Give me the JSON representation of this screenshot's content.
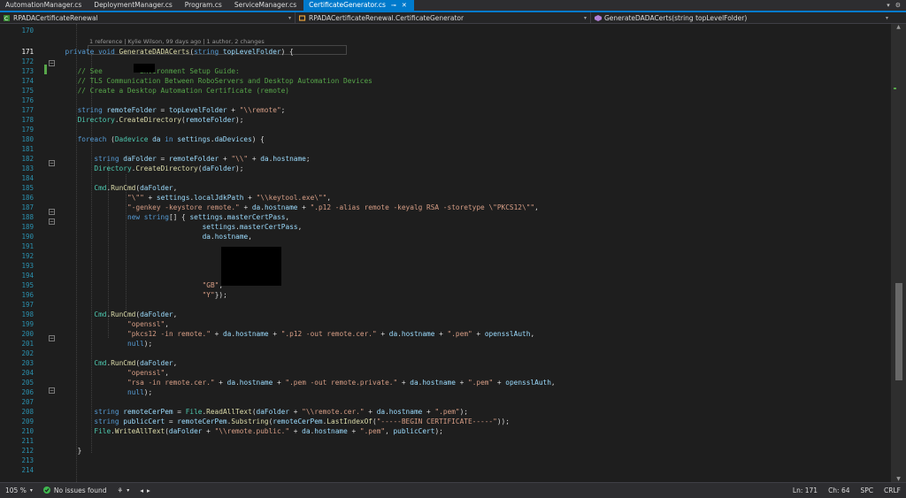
{
  "tabs": [
    {
      "label": "AutomationManager.cs",
      "active": false
    },
    {
      "label": "DeploymentManager.cs",
      "active": false
    },
    {
      "label": "Program.cs",
      "active": false
    },
    {
      "label": "ServiceManager.cs",
      "active": false
    },
    {
      "label": "CertificateGenerator.cs",
      "active": true
    }
  ],
  "tab_icons": {
    "pin": "pin-icon",
    "close": "close-icon",
    "overflow": "chevron-down-icon",
    "settings": "gear-icon"
  },
  "navbar": {
    "project": "RPADACertificateRenewal",
    "type": "RPADACertificateRenewal.CertificateGenerator",
    "member": "GenerateDADACerts(string topLevelFolder)"
  },
  "codelens": "1 reference | Kylie Wilson, 99 days ago | 1 author, 2 changes",
  "current_line": "171",
  "lines": [
    {
      "n": "170",
      "tokens": []
    },
    {
      "n": "171",
      "tokens": [
        {
          "t": "k",
          "x": "private "
        },
        {
          "t": "k",
          "x": "void "
        },
        {
          "t": "m",
          "x": "GenerateDADACerts"
        },
        {
          "t": "p",
          "x": "("
        },
        {
          "t": "k",
          "x": "string "
        },
        {
          "t": "v",
          "x": "topLevelFolder"
        },
        {
          "t": "p",
          "x": ") {"
        }
      ]
    },
    {
      "n": "172",
      "tokens": []
    },
    {
      "n": "173",
      "tokens": [
        {
          "t": "c",
          "x": "// See "
        },
        {
          "t": "c",
          "x": "        "
        },
        {
          "t": "c",
          "x": "Environment Setup Guide:"
        }
      ]
    },
    {
      "n": "174",
      "tokens": [
        {
          "t": "c",
          "x": "// TLS Communication Between RoboServers and Desktop Automation Devices"
        }
      ]
    },
    {
      "n": "175",
      "tokens": [
        {
          "t": "c",
          "x": "// Create a Desktop Automation Certificate (remote)"
        }
      ]
    },
    {
      "n": "176",
      "tokens": []
    },
    {
      "n": "177",
      "tokens": [
        {
          "t": "k",
          "x": "string "
        },
        {
          "t": "v",
          "x": "remoteFolder"
        },
        {
          "t": "p",
          "x": " = "
        },
        {
          "t": "v",
          "x": "topLevelFolder"
        },
        {
          "t": "p",
          "x": " + "
        },
        {
          "t": "s",
          "x": "\"\\\\remote\""
        },
        {
          "t": "p",
          "x": ";"
        }
      ]
    },
    {
      "n": "178",
      "tokens": [
        {
          "t": "t",
          "x": "Directory"
        },
        {
          "t": "p",
          "x": "."
        },
        {
          "t": "m",
          "x": "CreateDirectory"
        },
        {
          "t": "p",
          "x": "("
        },
        {
          "t": "v",
          "x": "remoteFolder"
        },
        {
          "t": "p",
          "x": ");"
        }
      ]
    },
    {
      "n": "179",
      "tokens": []
    },
    {
      "n": "180",
      "tokens": [
        {
          "t": "k",
          "x": "foreach "
        },
        {
          "t": "p",
          "x": "("
        },
        {
          "t": "t",
          "x": "Dadevice "
        },
        {
          "t": "v",
          "x": "da"
        },
        {
          "t": "k",
          "x": " in "
        },
        {
          "t": "v",
          "x": "settings"
        },
        {
          "t": "p",
          "x": "."
        },
        {
          "t": "v",
          "x": "daDevices"
        },
        {
          "t": "p",
          "x": ") {"
        }
      ]
    },
    {
      "n": "181",
      "tokens": []
    },
    {
      "n": "182",
      "tokens": [
        {
          "t": "k",
          "x": "string "
        },
        {
          "t": "v",
          "x": "daFolder"
        },
        {
          "t": "p",
          "x": " = "
        },
        {
          "t": "v",
          "x": "remoteFolder"
        },
        {
          "t": "p",
          "x": " + "
        },
        {
          "t": "s",
          "x": "\"\\\\\""
        },
        {
          "t": "p",
          "x": " + "
        },
        {
          "t": "v",
          "x": "da"
        },
        {
          "t": "p",
          "x": "."
        },
        {
          "t": "v",
          "x": "hostname"
        },
        {
          "t": "p",
          "x": ";"
        }
      ]
    },
    {
      "n": "183",
      "tokens": [
        {
          "t": "t",
          "x": "Directory"
        },
        {
          "t": "p",
          "x": "."
        },
        {
          "t": "m",
          "x": "CreateDirectory"
        },
        {
          "t": "p",
          "x": "("
        },
        {
          "t": "v",
          "x": "daFolder"
        },
        {
          "t": "p",
          "x": ");"
        }
      ]
    },
    {
      "n": "184",
      "tokens": []
    },
    {
      "n": "185",
      "tokens": [
        {
          "t": "t",
          "x": "Cmd"
        },
        {
          "t": "p",
          "x": "."
        },
        {
          "t": "m",
          "x": "RunCmd"
        },
        {
          "t": "p",
          "x": "("
        },
        {
          "t": "v",
          "x": "daFolder"
        },
        {
          "t": "p",
          "x": ","
        }
      ]
    },
    {
      "n": "186",
      "tokens": [
        {
          "t": "s",
          "x": "\"\\\"\""
        },
        {
          "t": "p",
          "x": " + "
        },
        {
          "t": "v",
          "x": "settings"
        },
        {
          "t": "p",
          "x": "."
        },
        {
          "t": "v",
          "x": "localJdkPath"
        },
        {
          "t": "p",
          "x": " + "
        },
        {
          "t": "s",
          "x": "\"\\\\keytool.exe\\\"\""
        },
        {
          "t": "p",
          "x": ","
        }
      ]
    },
    {
      "n": "187",
      "tokens": [
        {
          "t": "s",
          "x": "\"-genkey -keystore remote.\""
        },
        {
          "t": "p",
          "x": " + "
        },
        {
          "t": "v",
          "x": "da"
        },
        {
          "t": "p",
          "x": "."
        },
        {
          "t": "v",
          "x": "hostname"
        },
        {
          "t": "p",
          "x": " + "
        },
        {
          "t": "s",
          "x": "\".p12 -alias remote -keyalg RSA -storetype \\\"PKCS12\\\"\""
        },
        {
          "t": "p",
          "x": ","
        }
      ]
    },
    {
      "n": "188",
      "tokens": [
        {
          "t": "k",
          "x": "new "
        },
        {
          "t": "k",
          "x": "string"
        },
        {
          "t": "p",
          "x": "[] { "
        },
        {
          "t": "v",
          "x": "settings"
        },
        {
          "t": "p",
          "x": "."
        },
        {
          "t": "v",
          "x": "masterCertPass"
        },
        {
          "t": "p",
          "x": ","
        }
      ]
    },
    {
      "n": "189",
      "tokens": [
        {
          "t": "v",
          "x": "settings"
        },
        {
          "t": "p",
          "x": "."
        },
        {
          "t": "v",
          "x": "masterCertPass"
        },
        {
          "t": "p",
          "x": ","
        }
      ]
    },
    {
      "n": "190",
      "tokens": [
        {
          "t": "v",
          "x": "da"
        },
        {
          "t": "p",
          "x": "."
        },
        {
          "t": "v",
          "x": "hostname"
        },
        {
          "t": "p",
          "x": ","
        }
      ]
    },
    {
      "n": "191",
      "tokens": []
    },
    {
      "n": "192",
      "tokens": []
    },
    {
      "n": "193",
      "tokens": []
    },
    {
      "n": "194",
      "tokens": []
    },
    {
      "n": "195",
      "tokens": [
        {
          "t": "s",
          "x": "\"GB\""
        },
        {
          "t": "p",
          "x": ","
        }
      ]
    },
    {
      "n": "196",
      "tokens": [
        {
          "t": "s",
          "x": "\"Y\""
        },
        {
          "t": "p",
          "x": "});"
        }
      ]
    },
    {
      "n": "197",
      "tokens": []
    },
    {
      "n": "198",
      "tokens": [
        {
          "t": "t",
          "x": "Cmd"
        },
        {
          "t": "p",
          "x": "."
        },
        {
          "t": "m",
          "x": "RunCmd"
        },
        {
          "t": "p",
          "x": "("
        },
        {
          "t": "v",
          "x": "daFolder"
        },
        {
          "t": "p",
          "x": ","
        }
      ]
    },
    {
      "n": "199",
      "tokens": [
        {
          "t": "s",
          "x": "\"openssl\""
        },
        {
          "t": "p",
          "x": ","
        }
      ]
    },
    {
      "n": "200",
      "tokens": [
        {
          "t": "s",
          "x": "\"pkcs12 -in remote.\""
        },
        {
          "t": "p",
          "x": " + "
        },
        {
          "t": "v",
          "x": "da"
        },
        {
          "t": "p",
          "x": "."
        },
        {
          "t": "v",
          "x": "hostname"
        },
        {
          "t": "p",
          "x": " + "
        },
        {
          "t": "s",
          "x": "\".p12 -out remote.cer.\""
        },
        {
          "t": "p",
          "x": " + "
        },
        {
          "t": "v",
          "x": "da"
        },
        {
          "t": "p",
          "x": "."
        },
        {
          "t": "v",
          "x": "hostname"
        },
        {
          "t": "p",
          "x": " + "
        },
        {
          "t": "s",
          "x": "\".pem\""
        },
        {
          "t": "p",
          "x": " + "
        },
        {
          "t": "v",
          "x": "opensslAuth"
        },
        {
          "t": "p",
          "x": ","
        }
      ]
    },
    {
      "n": "201",
      "tokens": [
        {
          "t": "k",
          "x": "null"
        },
        {
          "t": "p",
          "x": ");"
        }
      ]
    },
    {
      "n": "202",
      "tokens": []
    },
    {
      "n": "203",
      "tokens": [
        {
          "t": "t",
          "x": "Cmd"
        },
        {
          "t": "p",
          "x": "."
        },
        {
          "t": "m",
          "x": "RunCmd"
        },
        {
          "t": "p",
          "x": "("
        },
        {
          "t": "v",
          "x": "daFolder"
        },
        {
          "t": "p",
          "x": ","
        }
      ]
    },
    {
      "n": "204",
      "tokens": [
        {
          "t": "s",
          "x": "\"openssl\""
        },
        {
          "t": "p",
          "x": ","
        }
      ]
    },
    {
      "n": "205",
      "tokens": [
        {
          "t": "s",
          "x": "\"rsa -in remote.cer.\""
        },
        {
          "t": "p",
          "x": " + "
        },
        {
          "t": "v",
          "x": "da"
        },
        {
          "t": "p",
          "x": "."
        },
        {
          "t": "v",
          "x": "hostname"
        },
        {
          "t": "p",
          "x": " + "
        },
        {
          "t": "s",
          "x": "\".pem -out remote.private.\""
        },
        {
          "t": "p",
          "x": " + "
        },
        {
          "t": "v",
          "x": "da"
        },
        {
          "t": "p",
          "x": "."
        },
        {
          "t": "v",
          "x": "hostname"
        },
        {
          "t": "p",
          "x": " + "
        },
        {
          "t": "s",
          "x": "\".pem\""
        },
        {
          "t": "p",
          "x": " + "
        },
        {
          "t": "v",
          "x": "opensslAuth"
        },
        {
          "t": "p",
          "x": ","
        }
      ]
    },
    {
      "n": "206",
      "tokens": [
        {
          "t": "k",
          "x": "null"
        },
        {
          "t": "p",
          "x": ");"
        }
      ]
    },
    {
      "n": "207",
      "tokens": []
    },
    {
      "n": "208",
      "tokens": [
        {
          "t": "k",
          "x": "string "
        },
        {
          "t": "v",
          "x": "remoteCerPem"
        },
        {
          "t": "p",
          "x": " = "
        },
        {
          "t": "t",
          "x": "File"
        },
        {
          "t": "p",
          "x": "."
        },
        {
          "t": "m",
          "x": "ReadAllText"
        },
        {
          "t": "p",
          "x": "("
        },
        {
          "t": "v",
          "x": "daFolder"
        },
        {
          "t": "p",
          "x": " + "
        },
        {
          "t": "s",
          "x": "\"\\\\remote.cer.\""
        },
        {
          "t": "p",
          "x": " + "
        },
        {
          "t": "v",
          "x": "da"
        },
        {
          "t": "p",
          "x": "."
        },
        {
          "t": "v",
          "x": "hostname"
        },
        {
          "t": "p",
          "x": " + "
        },
        {
          "t": "s",
          "x": "\".pem\""
        },
        {
          "t": "p",
          "x": ");"
        }
      ]
    },
    {
      "n": "209",
      "tokens": [
        {
          "t": "k",
          "x": "string "
        },
        {
          "t": "v",
          "x": "publicCert"
        },
        {
          "t": "p",
          "x": " = "
        },
        {
          "t": "v",
          "x": "remoteCerPem"
        },
        {
          "t": "p",
          "x": "."
        },
        {
          "t": "m",
          "x": "Substring"
        },
        {
          "t": "p",
          "x": "("
        },
        {
          "t": "v",
          "x": "remoteCerPem"
        },
        {
          "t": "p",
          "x": "."
        },
        {
          "t": "m",
          "x": "LastIndexOf"
        },
        {
          "t": "p",
          "x": "("
        },
        {
          "t": "s",
          "x": "\"-----BEGIN CERTIFICATE-----\""
        },
        {
          "t": "p",
          "x": "));"
        }
      ]
    },
    {
      "n": "210",
      "tokens": [
        {
          "t": "t",
          "x": "File"
        },
        {
          "t": "p",
          "x": "."
        },
        {
          "t": "m",
          "x": "WriteAllText"
        },
        {
          "t": "p",
          "x": "("
        },
        {
          "t": "v",
          "x": "daFolder"
        },
        {
          "t": "p",
          "x": " + "
        },
        {
          "t": "s",
          "x": "\"\\\\remote.public.\""
        },
        {
          "t": "p",
          "x": " + "
        },
        {
          "t": "v",
          "x": "da"
        },
        {
          "t": "p",
          "x": "."
        },
        {
          "t": "v",
          "x": "hostname"
        },
        {
          "t": "p",
          "x": " + "
        },
        {
          "t": "s",
          "x": "\".pem\""
        },
        {
          "t": "p",
          "x": ", "
        },
        {
          "t": "v",
          "x": "publicCert"
        },
        {
          "t": "p",
          "x": ");"
        }
      ]
    },
    {
      "n": "211",
      "tokens": []
    },
    {
      "n": "212",
      "tokens": [
        {
          "t": "p",
          "x": "}"
        }
      ]
    },
    {
      "n": "213",
      "tokens": []
    },
    {
      "n": "214",
      "tokens": []
    }
  ],
  "status": {
    "zoom": "105 %",
    "issues": "No issues found",
    "line": "Ln: 171",
    "col": "Ch: 64",
    "whitespace": "SPC",
    "eol": "CRLF"
  },
  "colors": {
    "accent": "#007acc",
    "ok": "#3fb950",
    "comment": "#57a64a"
  }
}
